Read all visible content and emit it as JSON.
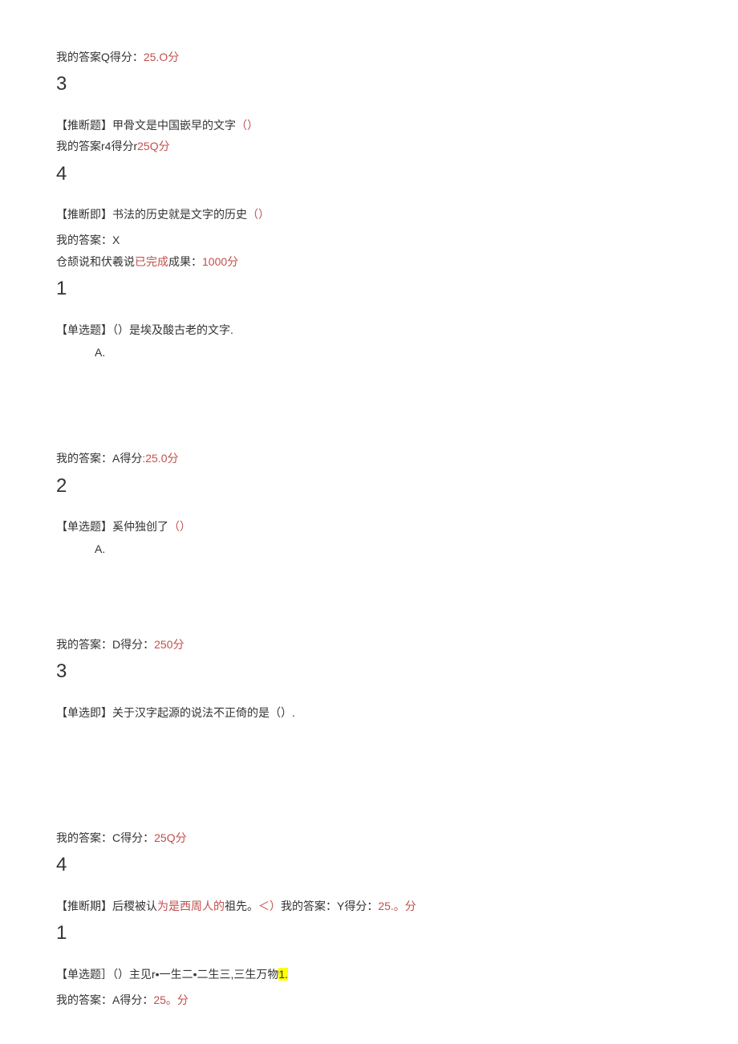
{
  "b1": {
    "prefix": "我的答案Q得分：",
    "score": "25.O分",
    "num": "3"
  },
  "b2": {
    "qtext_a": "【推断题】甲骨文是中国嵌早的文字",
    "qparen": "（）",
    "ans_prefix": "我的答案r4得分r",
    "ans_score": "25Q分",
    "num": "4"
  },
  "b3": {
    "qtext_a": "【推断即】书法的历史就是文字的历史",
    "qparen": "（）",
    "ans_line": "我的答案：X",
    "extra_a": "仓颉说和伏羲说",
    "extra_red1": "已完成",
    "extra_b": "成果：",
    "extra_red2": "1000分",
    "num": "1"
  },
  "b4": {
    "qtext": "【单选题】（）是埃及酸古老的文字.",
    "opt": "A.",
    "ans_prefix": "我的答案：A得分",
    "ans_score": ":25.0分",
    "num": "2"
  },
  "b5": {
    "qtext_a": "【单选题】奚仲独创了",
    "qparen": "（）",
    "opt": "A.",
    "ans_prefix": "我的答案：D得分：",
    "ans_score": "250分",
    "num": "3"
  },
  "b6": {
    "qtext": "【单选即】关于汉字起源的说法不正倚的是（）.",
    "ans_prefix": "我的答案：C得分：",
    "ans_score": "25Q分",
    "num": "4"
  },
  "b7": {
    "qtext_a": "【推断期】后稷被认",
    "qtext_red": "为是西周人的",
    "qtext_b": "祖先。",
    "qparen": "＜）",
    "ans_prefix": "我的答案：Y得分：",
    "ans_score": "25.。分",
    "num": "1"
  },
  "b8": {
    "qtext_a": "【单选题］（）主见r•一生二•二生三,三生万物",
    "qtext_hl": "1.",
    "ans_prefix": "我的答案：A得分：",
    "ans_score": "25。分"
  }
}
